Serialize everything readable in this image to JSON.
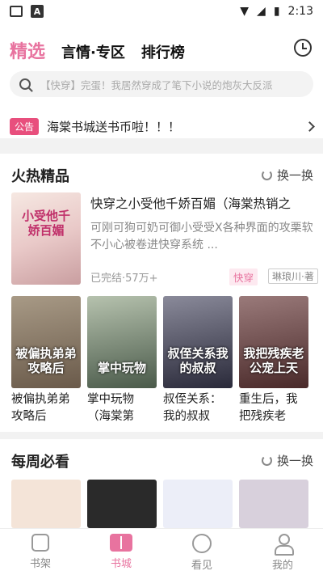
{
  "status": {
    "time": "2:13",
    "a_label": "A"
  },
  "header": {
    "tabs": [
      {
        "label": "精选",
        "active": true
      },
      {
        "label": "言情·专区",
        "active": false
      },
      {
        "label": "排行榜",
        "active": false
      }
    ],
    "search_placeholder": "【快穿】完蛋！我居然穿成了笔下小说的炮灰大反派",
    "notice": {
      "badge": "公告",
      "text": "海棠书城送书币啦！！！"
    }
  },
  "hot": {
    "title": "火热精品",
    "refresh_label": "换一换",
    "featured": {
      "title": "快穿之小受他千娇百媚（海棠热销之",
      "cover_text": "小受他千娇百媚",
      "description": "可刚可狗可奶可御小受受X各种界面的攻栗软不小心被卷进快穿系统 ...",
      "meta": "已完结·57万+",
      "tag": "快穿",
      "author": "琳琅川·著"
    },
    "books": [
      {
        "title": "被偏执弟弟攻略后（弟...",
        "cover_text": "被偏执弟弟攻略后",
        "color": "#6a5a4a"
      },
      {
        "title": "掌中玩物（海棠第一...",
        "cover_text": "掌中玩物",
        "color": "#5a6a5a"
      },
      {
        "title": "叔侄关系：我的叔叔（...",
        "cover_text": "叔侄关系我的叔叔",
        "color": "#3a3a4a"
      },
      {
        "title": "重生后，我把残疾老公...",
        "cover_text": "我把残疾老公宠上天",
        "color": "#5a3a3a"
      }
    ]
  },
  "weekly": {
    "title": "每周必看",
    "refresh_label": "换一换",
    "colors": [
      "#f4e4d8",
      "#2a2a2a",
      "#eceef8",
      "#d8d0dc"
    ]
  },
  "nav": [
    {
      "label": "书架",
      "active": false
    },
    {
      "label": "书城",
      "active": true
    },
    {
      "label": "看见",
      "active": false
    },
    {
      "label": "我的",
      "active": false
    }
  ]
}
